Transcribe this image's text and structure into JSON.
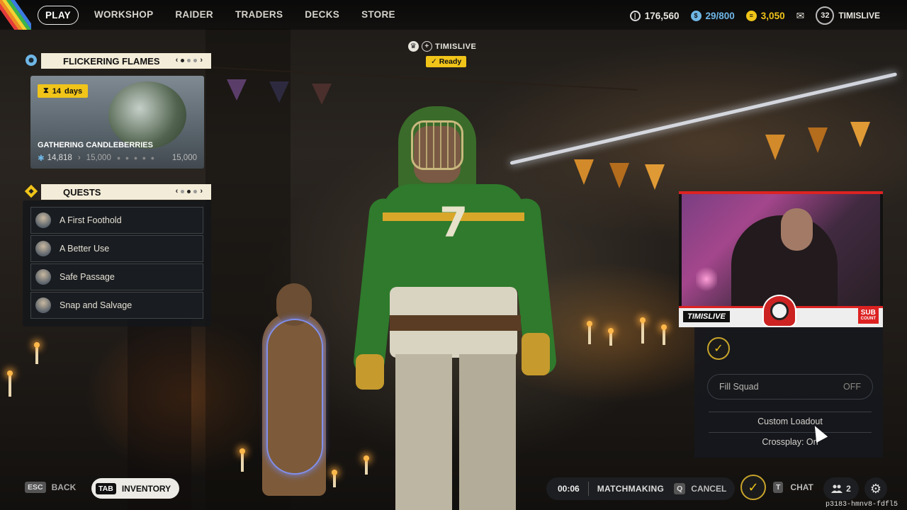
{
  "topbar": {
    "nav": [
      {
        "label": "PLAY",
        "active": true
      },
      {
        "label": "WORKSHOP",
        "active": false
      },
      {
        "label": "RAIDER",
        "active": false
      },
      {
        "label": "TRADERS",
        "active": false
      },
      {
        "label": "DECKS",
        "active": false
      },
      {
        "label": "STORE",
        "active": false
      }
    ],
    "currency_coins": "176,560",
    "currency_raider_tokens": "29/800",
    "currency_cred": "3,050",
    "player_level": "32",
    "player_name": "TIMISLIVE"
  },
  "event": {
    "title": "FLICKERING FLAMES",
    "days_left": "14",
    "days_label": "days",
    "card_title": "GATHERING CANDLEBERRIES",
    "progress_current": "14,818",
    "progress_next": "15,000",
    "progress_max": "15,000"
  },
  "quests": {
    "title": "QUESTS",
    "items": [
      "A First Foothold",
      "A Better Use",
      "Safe Passage",
      "Snap and Salvage"
    ]
  },
  "player_tag": {
    "name": "TIMISLIVE",
    "status": "Ready"
  },
  "webcam": {
    "name": "TIMISLIVE",
    "sub_label": "SUB",
    "sub_sub_label": "COUNT"
  },
  "squad": {
    "fill_label": "Fill Squad",
    "fill_value": "OFF",
    "custom_loadout": "Custom Loadout",
    "crossplay": "Crossplay: On"
  },
  "bottom": {
    "esc_key": "ESC",
    "back_label": "BACK",
    "tab_key": "TAB",
    "inventory_label": "INVENTORY",
    "timer": "00:06",
    "matchmaking": "MATCHMAKING",
    "cancel_key": "Q",
    "cancel_label": "CANCEL",
    "chat_key": "T",
    "chat_label": "CHAT",
    "friends_count": "2",
    "build_id": "p3183-hmnv8-fdfl5"
  },
  "colors": {
    "accent_yellow": "#f0c419",
    "panel_header": "#f3ecd8",
    "alert_red": "#d22"
  }
}
